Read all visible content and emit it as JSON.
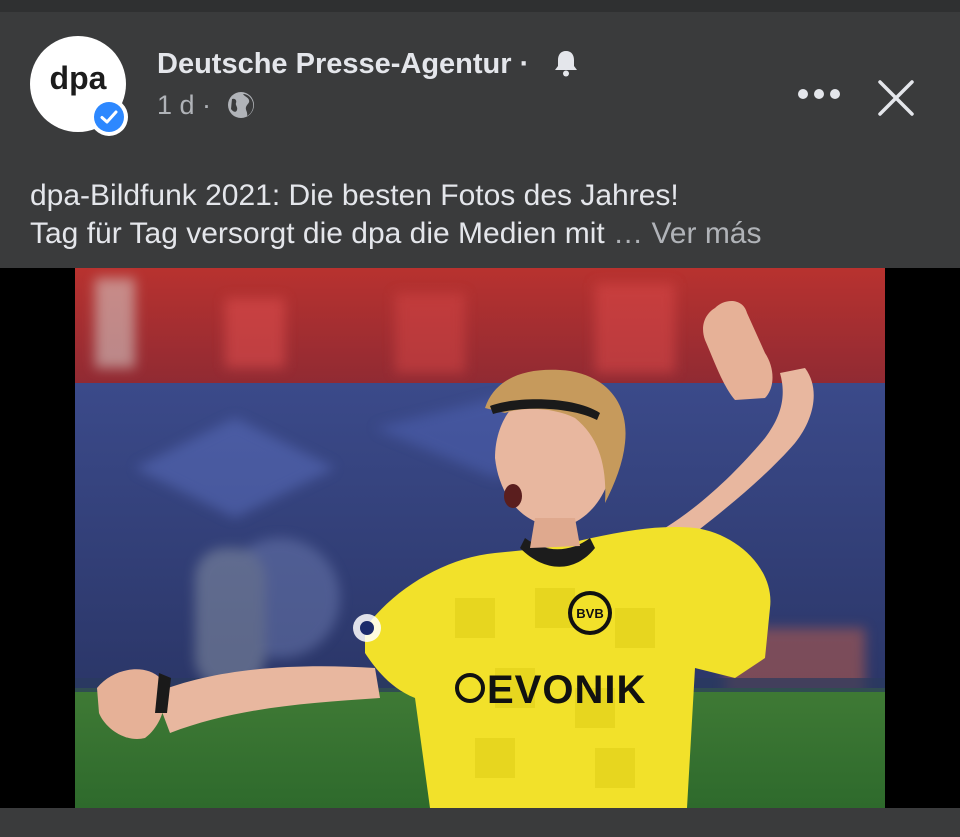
{
  "post": {
    "avatar_text": "dpa",
    "page_name": "Deutsche Presse-Agentur",
    "name_separator": "·",
    "time_ago": "1 d ·",
    "line1": "dpa-Bildfunk 2021: Die besten Fotos des Jahres!",
    "line2": "Tag für Tag versorgt die dpa die Medien mit",
    "ellipsis": "…",
    "see_more": "Ver más"
  },
  "photo": {
    "jersey_sponsor": "EVONIK",
    "badge_text": "BVB"
  },
  "colors": {
    "background": "#3a3b3c",
    "verified_blue": "#2d88ff",
    "jersey_yellow": "#f2e12a",
    "stands_red": "#c62f2f"
  },
  "icons": [
    "verified-badge-icon",
    "bell-icon",
    "globe-icon",
    "more-icon",
    "close-icon"
  ]
}
